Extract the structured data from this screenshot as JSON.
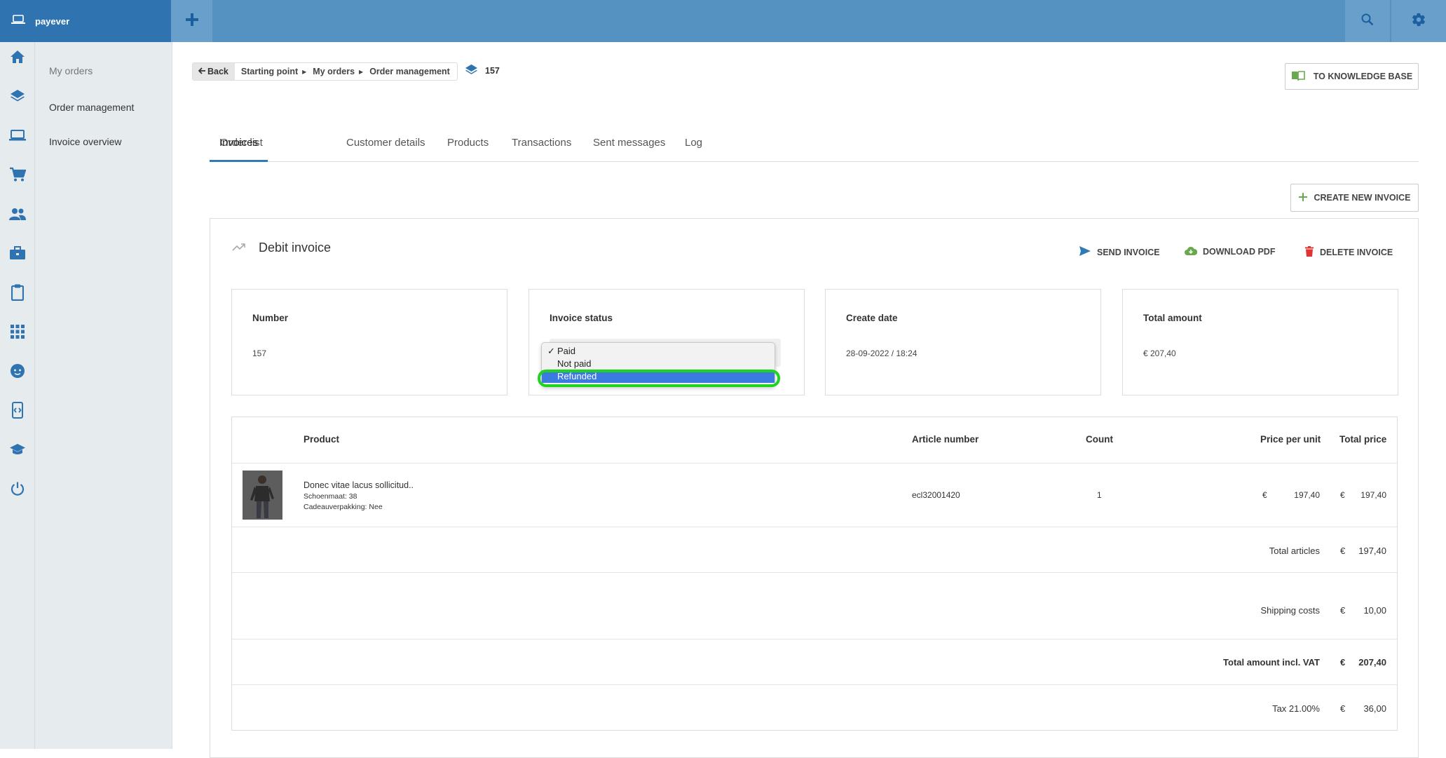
{
  "app": {
    "brand": "payever"
  },
  "subnav": {
    "items": [
      "My orders",
      "Order management",
      "Invoice overview"
    ]
  },
  "breadcrumb": {
    "back": "Back",
    "items": [
      "Starting point",
      "My orders",
      "Order management"
    ],
    "order_number": "157"
  },
  "knowledge_base_button": "TO KNOWLEDGE BASE",
  "tabs": [
    "Order list",
    "Invoices",
    "Customer details",
    "Products",
    "Transactions",
    "Sent messages",
    "Log"
  ],
  "active_tab": "Invoices",
  "create_invoice_button": "CREATE NEW INVOICE",
  "invoice": {
    "title": "Debit invoice",
    "actions": {
      "send": "SEND INVOICE",
      "download": "DOWNLOAD PDF",
      "delete": "DELETE INVOICE"
    },
    "number_label": "Number",
    "number_value": "157",
    "status_label": "Invoice status",
    "status_options": [
      "Paid",
      "Not paid",
      "Refunded"
    ],
    "status_selected": "Paid",
    "status_highlighted": "Refunded",
    "create_date_label": "Create date",
    "create_date_value": "28-09-2022 / 18:24",
    "total_label": "Total amount",
    "total_value": "€ 207,40"
  },
  "products_table": {
    "headers": {
      "product": "Product",
      "article": "Article number",
      "count": "Count",
      "ppu": "Price per unit",
      "total": "Total price"
    },
    "rows": [
      {
        "name": "Donec vitae lacus sollicitud..",
        "attr1": "Schoenmaat: 38",
        "attr2": "Cadeauverpakking: Nee",
        "article": "ecl32001420",
        "count": "1",
        "ppu_currency": "€",
        "ppu": "197,40",
        "total_currency": "€",
        "total": "197,40"
      }
    ],
    "summary": [
      {
        "label": "Total articles",
        "currency": "€",
        "value": "197,40",
        "bold": false
      },
      {
        "label": "Shipping costs",
        "currency": "€",
        "value": "10,00",
        "bold": false
      },
      {
        "label": "Total amount incl. VAT",
        "currency": "€",
        "value": "207,40",
        "bold": true
      },
      {
        "label": "Tax 21.00%",
        "currency": "€",
        "value": "36,00",
        "bold": false
      }
    ]
  },
  "colors": {
    "topbar": "#5591c1",
    "brand": "#2f73b0",
    "accent": "#2f7ab8",
    "highlight_ring": "#21d321",
    "green_icon": "#6aa84f",
    "delete_red": "#e03434"
  }
}
